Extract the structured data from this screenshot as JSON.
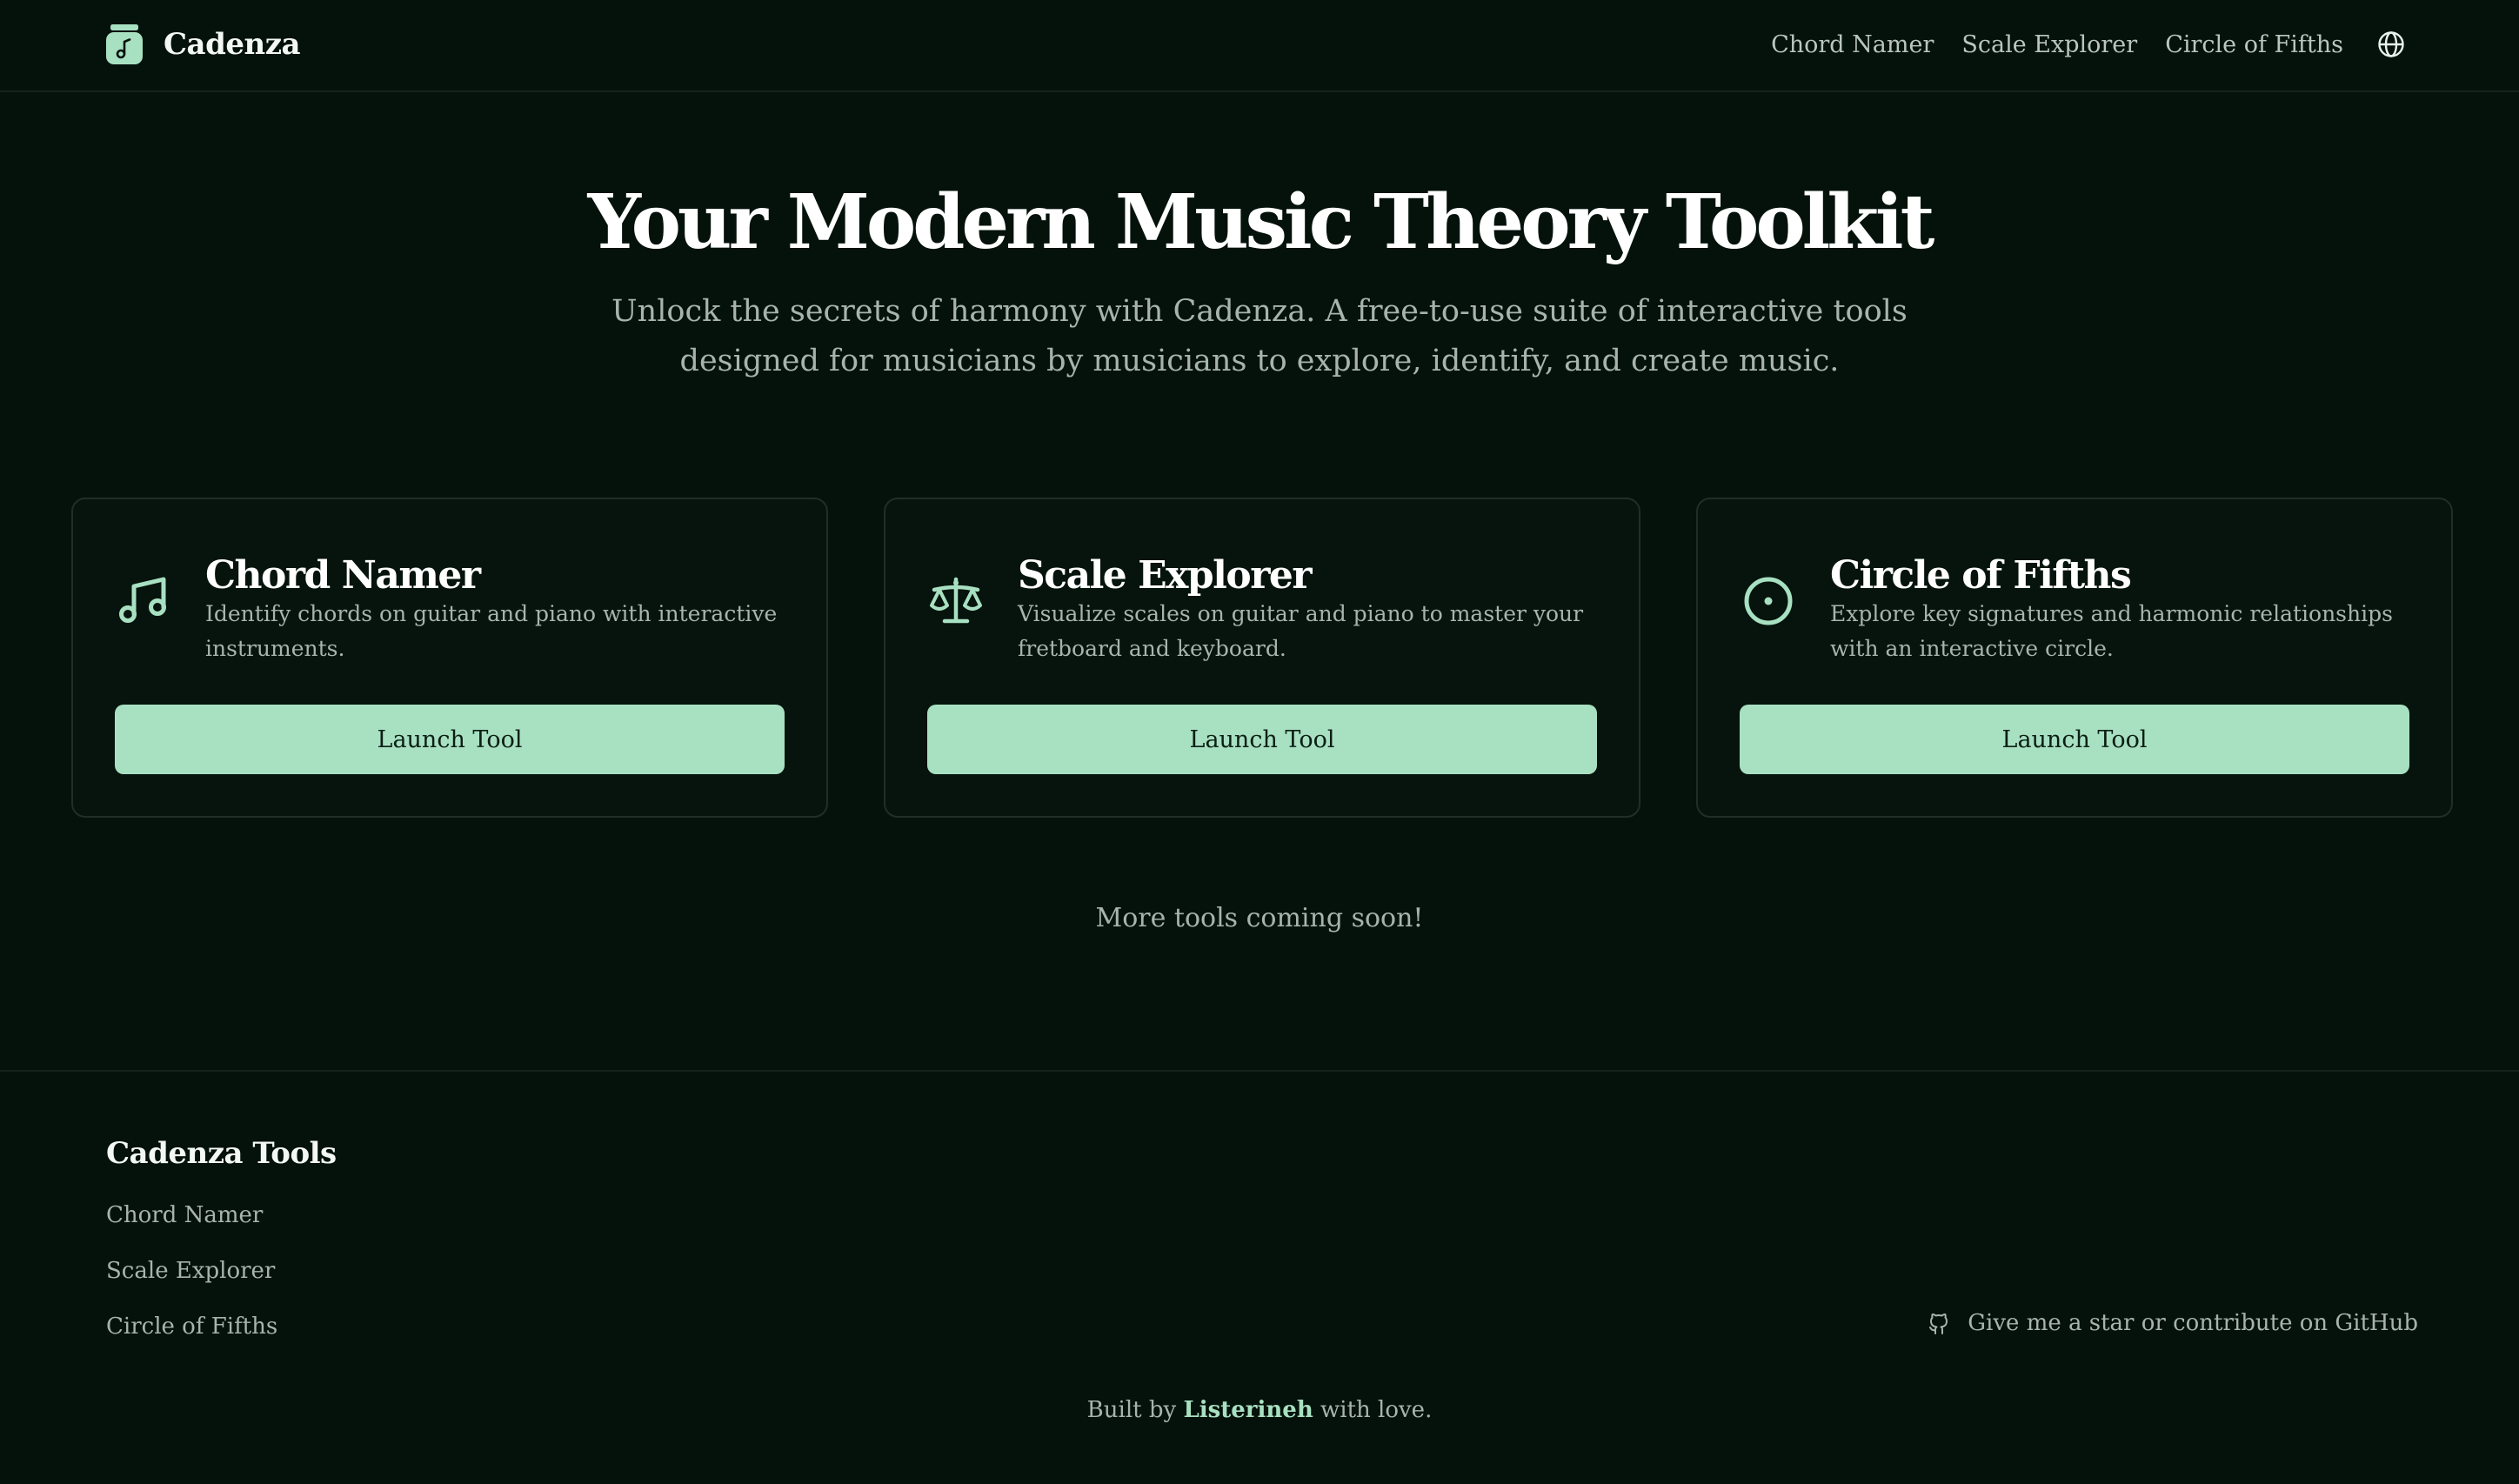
{
  "header": {
    "brand_name": "Cadenza",
    "brand_icon": "music-jar-logo",
    "nav": [
      {
        "label": "Chord Namer"
      },
      {
        "label": "Scale Explorer"
      },
      {
        "label": "Circle of Fifths"
      }
    ],
    "language_icon": "globe-icon"
  },
  "hero": {
    "title": "Your Modern Music Theory Toolkit",
    "subtitle": "Unlock the secrets of harmony with Cadenza. A free-to-use suite of interactive tools designed for musicians by musicians to explore, identify, and create music."
  },
  "tools": [
    {
      "title": "Chord Namer",
      "description": "Identify chords on guitar and piano with interactive instruments.",
      "icon": "music-note-icon",
      "button_label": "Launch Tool"
    },
    {
      "title": "Scale Explorer",
      "description": "Visualize scales on guitar and piano to master your fretboard and keyboard.",
      "icon": "scale-balance-icon",
      "button_label": "Launch Tool"
    },
    {
      "title": "Circle of Fifths",
      "description": "Explore key signatures and harmonic relationships with an interactive circle.",
      "icon": "circle-dot-icon",
      "button_label": "Launch Tool"
    }
  ],
  "more_tools_text": "More tools coming soon!",
  "footer": {
    "heading": "Cadenza Tools",
    "links": [
      {
        "label": "Chord Namer"
      },
      {
        "label": "Scale Explorer"
      },
      {
        "label": "Circle of Fifths"
      }
    ],
    "github_text": "Give me a star or contribute on GitHub",
    "github_icon": "github-icon",
    "credit_prefix": "Built by",
    "credit_author": "Listerineh",
    "credit_suffix": "with love."
  },
  "colors": {
    "background": "#04120b",
    "accent": "#a8e0c2",
    "text_primary": "#ffffff",
    "text_muted": "#a7b4ac",
    "card_border": "#1f2f26"
  }
}
